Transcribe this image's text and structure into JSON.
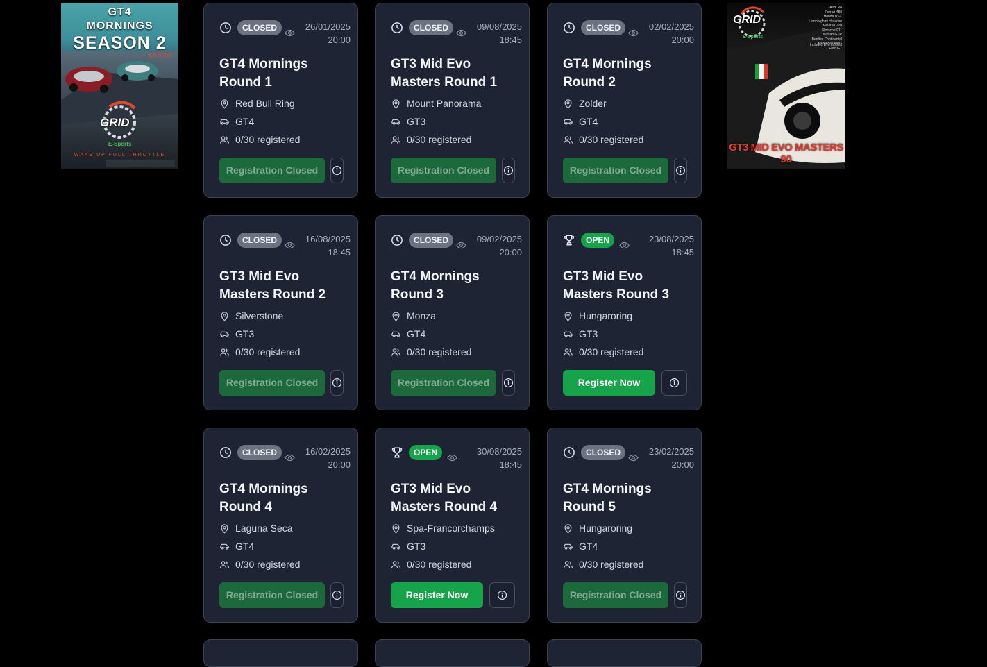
{
  "posters": {
    "left": {
      "line1": "GT4",
      "line2": "MORNINGS",
      "line3": "SEASON 2",
      "line4": "SPRINT",
      "logo": "GRID",
      "sub": "E-Sports",
      "tagline": "WAKE UP FULL THROTTLE"
    },
    "right": {
      "logo": "GRID",
      "sub": "E-Sports",
      "title": "GT3 MID EVO MASTERS 90",
      "cars": [
        "Audi R8",
        "Ferrari 488",
        "Honda NSX",
        "Lamborghini Huracan",
        "Mclaren 720",
        "Porsche 911",
        "Nissan GTR",
        "Bentley Continental",
        "Mercedes AMG",
        "Ford GT"
      ],
      "evo_note": "Includes Evo models"
    }
  },
  "events": [
    {
      "status": "CLOSED",
      "date": "26/01/2025",
      "time": "20:00",
      "title": "GT4 Mornings Round 1",
      "track": "Red Bull Ring",
      "car_class": "GT4",
      "registered": "0/30 registered",
      "button": "Registration Closed"
    },
    {
      "status": "CLOSED",
      "date": "09/08/2025",
      "time": "18:45",
      "title": "GT3 Mid Evo Masters Round 1",
      "track": "Mount Panorama",
      "car_class": "GT3",
      "registered": "0/30 registered",
      "button": "Registration Closed"
    },
    {
      "status": "CLOSED",
      "date": "02/02/2025",
      "time": "20:00",
      "title": "GT4 Mornings Round 2",
      "track": "Zolder",
      "car_class": "GT4",
      "registered": "0/30 registered",
      "button": "Registration Closed"
    },
    {
      "status": "CLOSED",
      "date": "16/08/2025",
      "time": "18:45",
      "title": "GT3 Mid Evo Masters Round 2",
      "track": "Silverstone",
      "car_class": "GT3",
      "registered": "0/30 registered",
      "button": "Registration Closed"
    },
    {
      "status": "CLOSED",
      "date": "09/02/2025",
      "time": "20:00",
      "title": "GT4 Mornings Round 3",
      "track": "Monza",
      "car_class": "GT4",
      "registered": "0/30 registered",
      "button": "Registration Closed"
    },
    {
      "status": "OPEN",
      "date": "23/08/2025",
      "time": "18:45",
      "title": "GT3 Mid Evo Masters Round 3",
      "track": "Hungaroring",
      "car_class": "GT3",
      "registered": "0/30 registered",
      "button": "Register Now"
    },
    {
      "status": "CLOSED",
      "date": "16/02/2025",
      "time": "20:00",
      "title": "GT4 Mornings Round 4",
      "track": "Laguna Seca",
      "car_class": "GT4",
      "registered": "0/30 registered",
      "button": "Registration Closed"
    },
    {
      "status": "OPEN",
      "date": "30/08/2025",
      "time": "18:45",
      "title": "GT3 Mid Evo Masters Round 4",
      "track": "Spa-Francorchamps",
      "car_class": "GT3",
      "registered": "0/30 registered",
      "button": "Register Now"
    },
    {
      "status": "CLOSED",
      "date": "23/02/2025",
      "time": "20:00",
      "title": "GT4 Mornings Round 5",
      "track": "Hungaroring",
      "car_class": "GT4",
      "registered": "0/30 registered",
      "button": "Registration Closed"
    }
  ],
  "icons": {
    "closed_status": "clock-icon",
    "open_status": "trophy-icon",
    "views": "eye-icon",
    "location": "map-pin-icon",
    "car": "car-icon",
    "drivers": "users-icon",
    "info": "info-icon"
  },
  "colors": {
    "background": "#000000",
    "card": "#1e2433",
    "open_green": "#16a34a",
    "closed_button": "#1c6a3c",
    "closed_badge": "#6b7280"
  }
}
